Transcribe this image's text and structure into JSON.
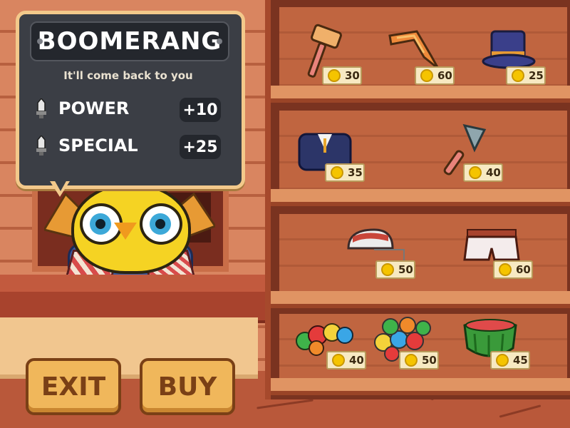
{
  "tooltip": {
    "item_name": "BOOMERANG",
    "tagline": "It'll come back to you",
    "stats": [
      {
        "label": "POWER",
        "value": "+10"
      },
      {
        "label": "SPECIAL",
        "value": "+25"
      }
    ]
  },
  "buttons": {
    "exit": "EXIT",
    "buy": "BUY"
  },
  "shop_items": [
    {
      "icon": "hammer-icon",
      "price": "30"
    },
    {
      "icon": "boomerang-icon",
      "price": "60"
    },
    {
      "icon": "top-hat-icon",
      "price": "25"
    },
    {
      "icon": "suit-icon",
      "price": "35"
    },
    {
      "icon": "trowel-icon",
      "price": "40"
    },
    {
      "icon": "helmet-icon",
      "price": "50"
    },
    {
      "icon": "shorts-icon",
      "price": "60"
    },
    {
      "icon": "gumballs-icon",
      "price": "40"
    },
    {
      "icon": "gumball-pile-icon",
      "price": "50"
    },
    {
      "icon": "watermelon-icon",
      "price": "45"
    }
  ],
  "colors": {
    "panel": "#3b3e45",
    "panel_border": "#f3c98b",
    "button": "#f0b75b",
    "button_text": "#7a4016",
    "coin": "#f5c400"
  }
}
